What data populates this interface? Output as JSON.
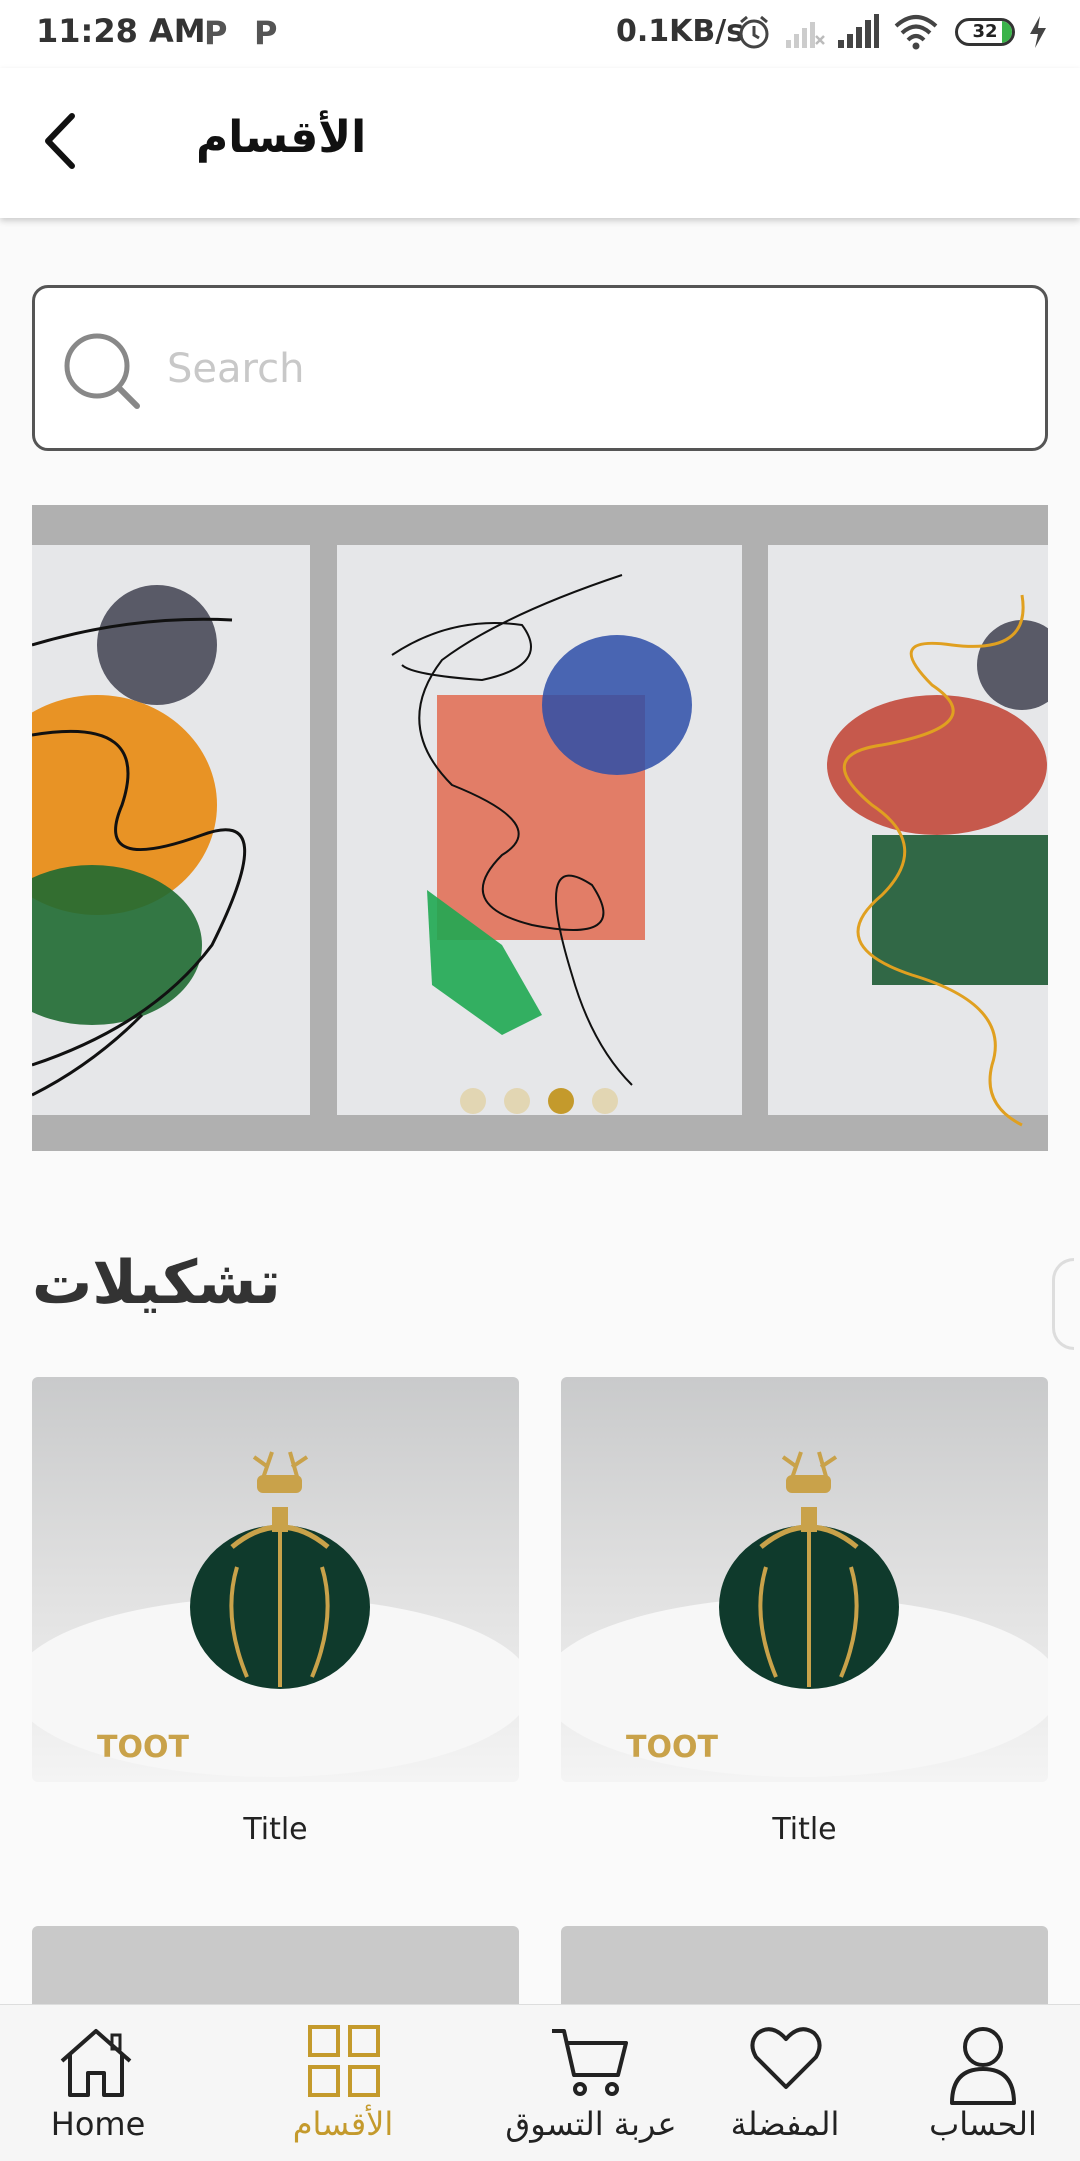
{
  "status_bar": {
    "time": "11:28 AM",
    "p1": "P",
    "p2": "P",
    "network_speed": "0.1KB/s",
    "battery": "32",
    "icons": [
      "alarm-icon",
      "signal-off-icon",
      "signal-icon",
      "wifi-icon",
      "battery-icon",
      "charging-icon"
    ]
  },
  "header": {
    "title": "الأقسام",
    "back_icon": "chevron-left-icon"
  },
  "search": {
    "placeholder": "Search",
    "value": ""
  },
  "banner": {
    "slide_count": 4,
    "active_slide": 3
  },
  "section": {
    "title": "تشكيلات"
  },
  "products": [
    {
      "title": "Title"
    },
    {
      "title": "Title"
    }
  ],
  "bottom_nav": [
    {
      "label": "Home",
      "icon": "home-icon",
      "active": false
    },
    {
      "label": "الأقسام",
      "icon": "grid-icon",
      "active": true
    },
    {
      "label": "عربة التسوق",
      "icon": "cart-icon",
      "active": false
    },
    {
      "label": "المفضلة",
      "icon": "heart-icon",
      "active": false
    },
    {
      "label": "الحساب",
      "icon": "user-icon",
      "active": false
    }
  ],
  "colors": {
    "accent": "#c49a2c",
    "dot_inactive": "#e2d6b3",
    "banner_bg": "#b0b0b0"
  }
}
